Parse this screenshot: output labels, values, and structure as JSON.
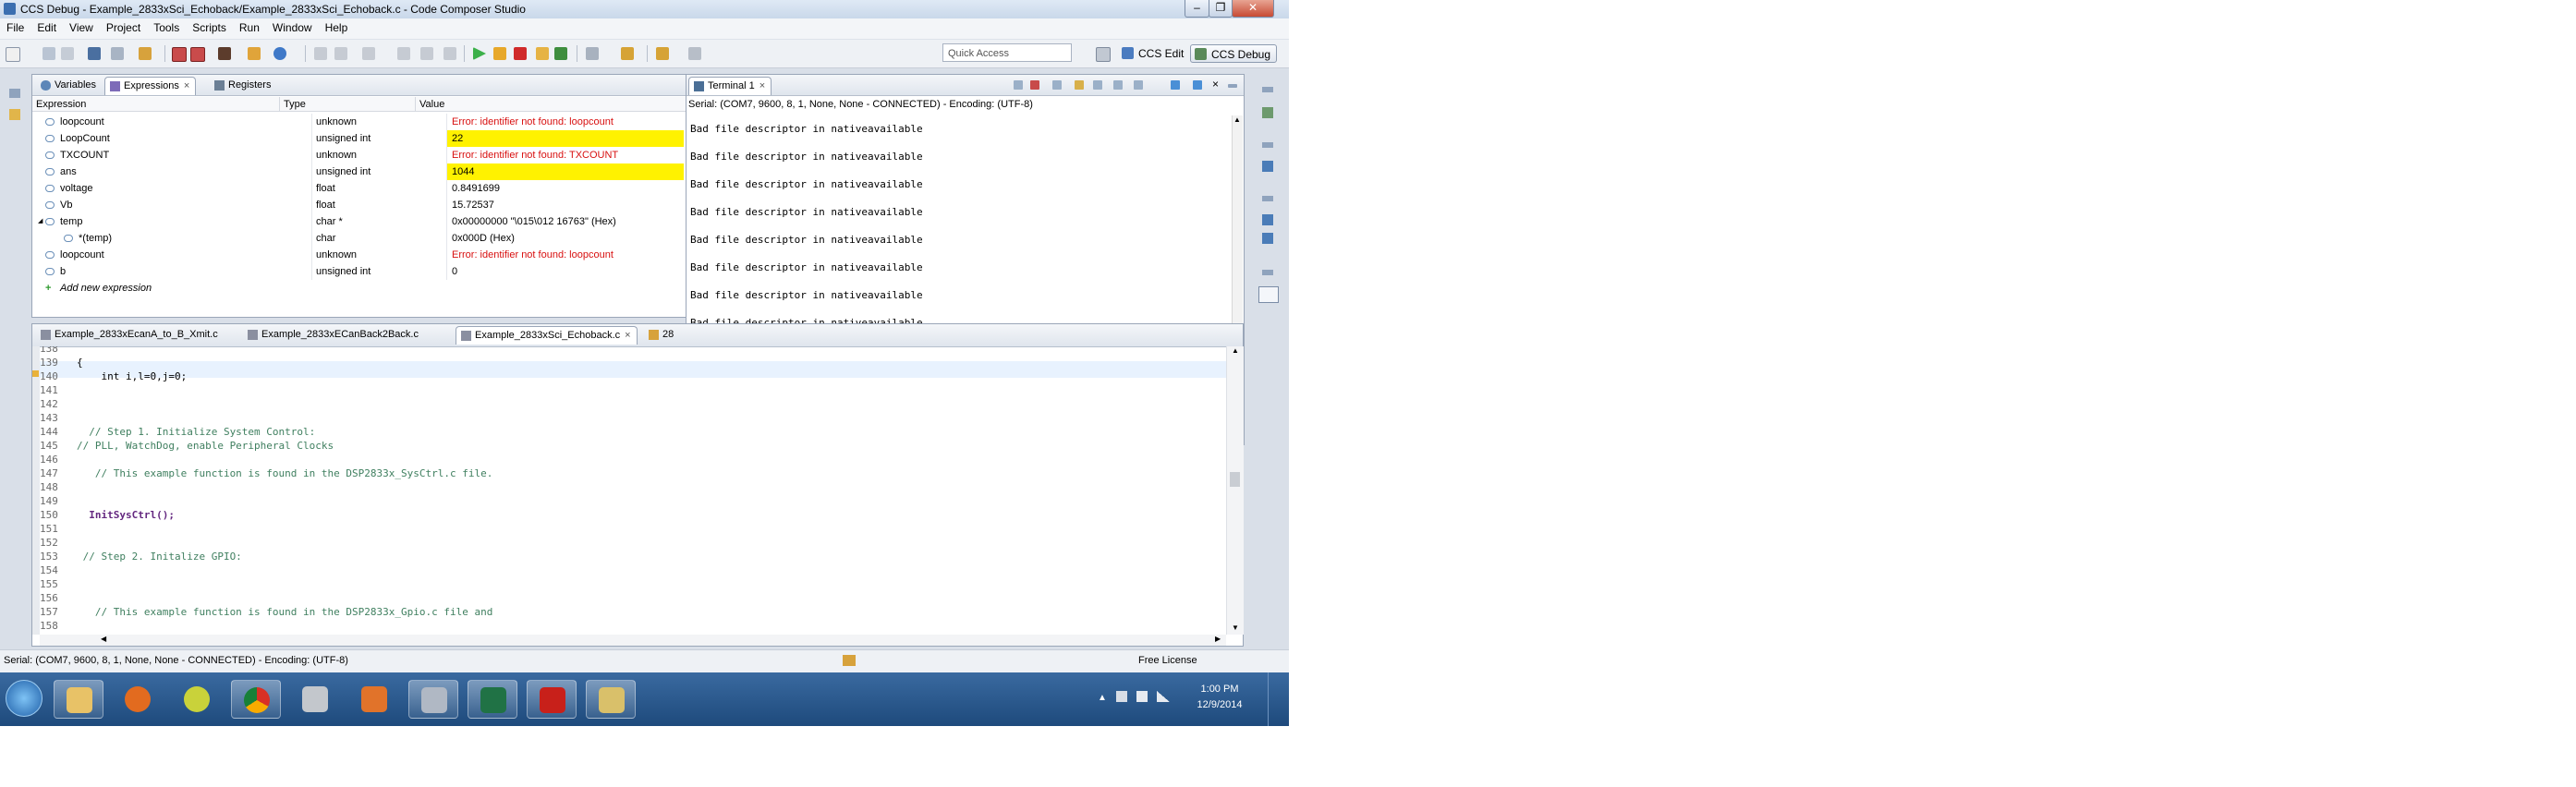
{
  "window": {
    "title": "CCS Debug - Example_2833xSci_Echoback/Example_2833xSci_Echoback.c - Code Composer Studio"
  },
  "menu": [
    "File",
    "Edit",
    "View",
    "Project",
    "Tools",
    "Scripts",
    "Run",
    "Window",
    "Help"
  ],
  "toolbar": {
    "quick_access": "Quick Access",
    "perspectives": [
      {
        "label": "CCS Edit"
      },
      {
        "label": "CCS Debug"
      }
    ]
  },
  "expressions_view": {
    "tabs": [
      "Variables",
      "Expressions",
      "Registers"
    ],
    "columns": [
      "Expression",
      "Type",
      "Value"
    ],
    "rows": [
      {
        "expression": "loopcount",
        "type": "unknown",
        "value": "Error: identifier not found: loopcount",
        "status": "error"
      },
      {
        "expression": "LoopCount",
        "type": "unsigned int",
        "value": "22",
        "status": "changed"
      },
      {
        "expression": "TXCOUNT",
        "type": "unknown",
        "value": "Error: identifier not found: TXCOUNT",
        "status": "error"
      },
      {
        "expression": "ans",
        "type": "unsigned int",
        "value": "1044",
        "status": "changed"
      },
      {
        "expression": "voltage",
        "type": "float",
        "value": "0.8491699",
        "status": "normal"
      },
      {
        "expression": "Vb",
        "type": "float",
        "value": "15.72537",
        "status": "normal"
      },
      {
        "expression": "temp",
        "type": "char *",
        "value": "0x00000000 \"\\015\\012  16763\" (Hex)",
        "status": "normal"
      },
      {
        "expression": "*(temp)",
        "type": "char",
        "value": "0x000D (Hex)",
        "status": "normal"
      },
      {
        "expression": "loopcount",
        "type": "unknown",
        "value": "Error: identifier not found: loopcount",
        "status": "error"
      },
      {
        "expression": "b",
        "type": "unsigned int",
        "value": "0",
        "status": "normal"
      }
    ],
    "add_new": "Add new expression"
  },
  "editor": {
    "tabs": [
      "Example_2833xEcanA_to_B_Xmit.c",
      "Example_2833xECanBack2Back.c",
      "Example_2833xSci_Echoback.c",
      "28"
    ],
    "lines": [
      {
        "num": "138",
        "text": ""
      },
      {
        "num": "139",
        "text": "{"
      },
      {
        "num": "140",
        "text": "    int i,l=0,j=0;"
      },
      {
        "num": "141",
        "text": ""
      },
      {
        "num": "142",
        "text": ""
      },
      {
        "num": "143",
        "text": ""
      },
      {
        "num": "144",
        "text": "  // Step 1. Initialize System Control:"
      },
      {
        "num": "145",
        "text": "// PLL, WatchDog, enable Peripheral Clocks"
      },
      {
        "num": "146",
        "text": ""
      },
      {
        "num": "147",
        "text": "   // This example function is found in the DSP2833x_SysCtrl.c file."
      },
      {
        "num": "148",
        "text": ""
      },
      {
        "num": "149",
        "text": ""
      },
      {
        "num": "150",
        "text": "  InitSysCtrl();"
      },
      {
        "num": "151",
        "text": ""
      },
      {
        "num": "152",
        "text": ""
      },
      {
        "num": "153",
        "text": " // Step 2. Initalize GPIO:"
      },
      {
        "num": "154",
        "text": ""
      },
      {
        "num": "155",
        "text": ""
      },
      {
        "num": "156",
        "text": ""
      },
      {
        "num": "157",
        "text": "   // This example function is found in the DSP2833x_Gpio.c file and"
      },
      {
        "num": "158",
        "text": ""
      }
    ]
  },
  "terminal": {
    "tab": "Terminal 1",
    "header": "Serial: (COM7, 9600, 8, 1, None, None - CONNECTED) - Encoding: (UTF-8)",
    "lines": [
      "Bad file descriptor in nativeavailable",
      "Bad file descriptor in nativeavailable",
      "Bad file descriptor in nativeavailable",
      "Bad file descriptor in nativeavailable",
      "Bad file descriptor in nativeavailable",
      "Bad file descriptor in nativeavailable",
      "Bad file descriptor in nativeavailable",
      "Bad file descriptor in nativeavailable",
      "Bad file descriptor in nativeavailable",
      "Bad file descriptor in nativeavailable",
      "Bad file descriptor in nativeavailable"
    ]
  },
  "statusbar": {
    "text": "Serial: (COM7, 9600, 8, 1, None, None - CONNECTED) - Encoding: (UTF-8)",
    "license": "Free License"
  },
  "taskbar": {
    "apps": [
      "start-orb",
      "file-explorer",
      "firefox",
      "media-player",
      "chrome",
      "virtualbox",
      "matlab",
      "ccs",
      "excel",
      "acrobat",
      "folder-tools"
    ],
    "time": "1:00 PM",
    "date": "12/9/2014"
  },
  "colors": {
    "error": "#d81010",
    "changed_highlight": "#fff200",
    "comment": "#3f7f5f",
    "keyword": "#7f0055"
  }
}
